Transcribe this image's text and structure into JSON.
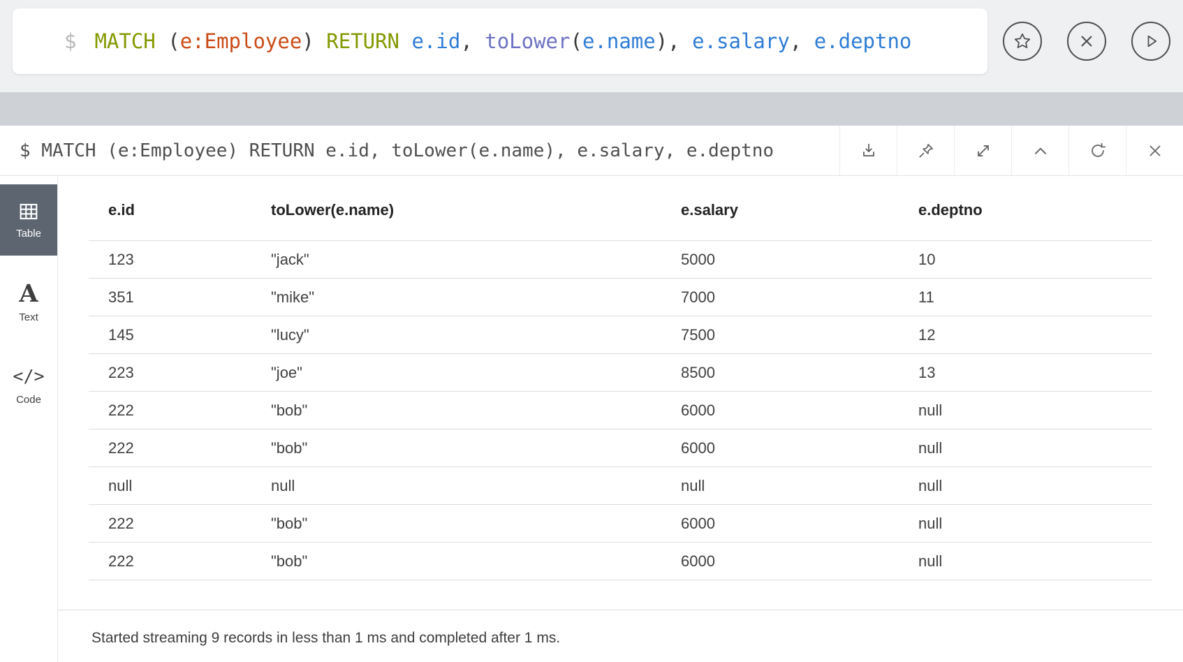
{
  "colors": {
    "keyword": "#859900",
    "label": "#cb4b16",
    "property": "#2e7cd6",
    "function": "#6c71c4",
    "plain": "#383838",
    "sidebar_active_bg": "#5c6570"
  },
  "editor": {
    "prompt": "$",
    "tokens": [
      {
        "t": "MATCH",
        "c": "keyword"
      },
      {
        "t": " (",
        "c": "plain"
      },
      {
        "t": "e:Employee",
        "c": "label"
      },
      {
        "t": ")",
        "c": "plain"
      },
      {
        "t": " RETURN",
        "c": "keyword"
      },
      {
        "t": " e.id",
        "c": "property"
      },
      {
        "t": ",",
        "c": "plain"
      },
      {
        "t": " toLower",
        "c": "function"
      },
      {
        "t": "(",
        "c": "plain"
      },
      {
        "t": "e.name",
        "c": "property"
      },
      {
        "t": ")",
        "c": "plain"
      },
      {
        "t": ",",
        "c": "plain"
      },
      {
        "t": " e.salary",
        "c": "property"
      },
      {
        "t": ",",
        "c": "plain"
      },
      {
        "t": " e.deptno",
        "c": "property"
      }
    ],
    "buttons": [
      {
        "name": "favorite",
        "icon": "star-icon"
      },
      {
        "name": "close",
        "icon": "close-icon"
      },
      {
        "name": "run",
        "icon": "play-icon"
      }
    ]
  },
  "frame": {
    "query_text": "$ MATCH (e:Employee) RETURN e.id, toLower(e.name), e.salary, e.deptno",
    "toolbar": [
      {
        "icon": "download-icon"
      },
      {
        "icon": "pin-icon"
      },
      {
        "icon": "expand-icon"
      },
      {
        "icon": "collapse-icon"
      },
      {
        "icon": "rerun-icon"
      },
      {
        "icon": "close-icon"
      }
    ],
    "sidebar": {
      "items": [
        {
          "label": "Table",
          "icon": "table-icon",
          "active": true
        },
        {
          "label": "Text",
          "icon": "text-icon",
          "glyph": "A",
          "active": false
        },
        {
          "label": "Code",
          "icon": "code-icon",
          "glyph": "</>",
          "active": false
        }
      ]
    },
    "table": {
      "columns": [
        "e.id",
        "toLower(e.name)",
        "e.salary",
        "e.deptno"
      ],
      "rows": [
        [
          "123",
          "\"jack\"",
          "5000",
          "10"
        ],
        [
          "351",
          "\"mike\"",
          "7000",
          "11"
        ],
        [
          "145",
          "\"lucy\"",
          "7500",
          "12"
        ],
        [
          "223",
          "\"joe\"",
          "8500",
          "13"
        ],
        [
          "222",
          "\"bob\"",
          "6000",
          "null"
        ],
        [
          "222",
          "\"bob\"",
          "6000",
          "null"
        ],
        [
          "null",
          "null",
          "null",
          "null"
        ],
        [
          "222",
          "\"bob\"",
          "6000",
          "null"
        ],
        [
          "222",
          "\"bob\"",
          "6000",
          "null"
        ]
      ]
    },
    "status": "Started streaming 9 records in less than 1 ms and completed after 1 ms."
  }
}
